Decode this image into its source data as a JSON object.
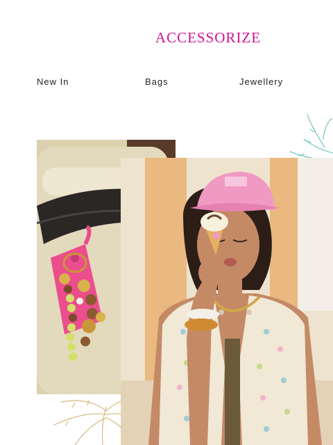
{
  "brand": {
    "logo_text": "ACCESSORIZE",
    "color": "#d0138f"
  },
  "nav": {
    "items": [
      "New In",
      "Bags",
      "Jewellery"
    ]
  },
  "hero": {
    "left_image": "luggage-with-pink-bag-charm",
    "right_image": "woman-in-pink-cap-with-ice-cream",
    "colors": {
      "cream": "#e9dfc4",
      "pink": "#ec4d8c",
      "cap_pink": "#f09ac3"
    }
  }
}
